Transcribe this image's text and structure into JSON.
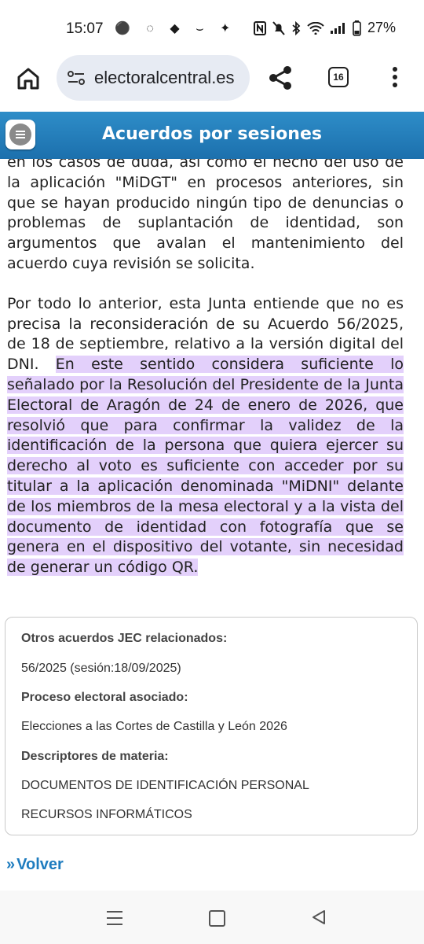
{
  "status": {
    "time": "15:07",
    "battery": "27%",
    "left_icons": "⚫ ◌ ◆ ⌣ ✦"
  },
  "browser": {
    "url": "electoralcentral.es",
    "tab_count": "16"
  },
  "header": {
    "title": "Acuerdos por sesiones"
  },
  "body": {
    "para1": "en los casos de duda, así como el hecho del uso de la aplicación \"MiDGT\" en procesos anteriores, sin que se hayan producido ningún tipo de denuncias o problemas de suplantación de identidad, son argumentos que avalan el mantenimiento del acuerdo cuya revisión se solicita.",
    "para2_plain": "Por todo lo anterior, esta Junta entiende que no es precisa la reconsideración de su Acuerdo 56/2025, de 18 de septiembre, relativo a la versión digital del DNI.",
    "para2_highlight": "En este sentido considera suficiente lo señalado por la Resolución del Presidente de la Junta Electoral de Aragón de 24 de enero de 2026, que resolvió que para confirmar la validez de la identificación de la persona que quiera ejercer su derecho al voto es suficiente con acceder por su titular a la aplicación denominada \"MiDNI\" delante de los miembros de la mesa electoral y a la vista del documento de identidad con fotografía que se genera en el dispositivo del votante, sin necesidad de generar un código QR."
  },
  "info": {
    "related_label": "Otros acuerdos JEC relacionados:",
    "related_value": "56/2025 (sesión:18/09/2025)",
    "process_label": "Proceso electoral asociado:",
    "process_value": "Elecciones a las Cortes de Castilla y León 2026",
    "descriptors_label": "Descriptores de materia:",
    "descriptor_1": "DOCUMENTOS DE IDENTIFICACIÓN PERSONAL",
    "descriptor_2": "RECURSOS INFORMÁTICOS"
  },
  "footer": {
    "back_label": "Volver"
  }
}
